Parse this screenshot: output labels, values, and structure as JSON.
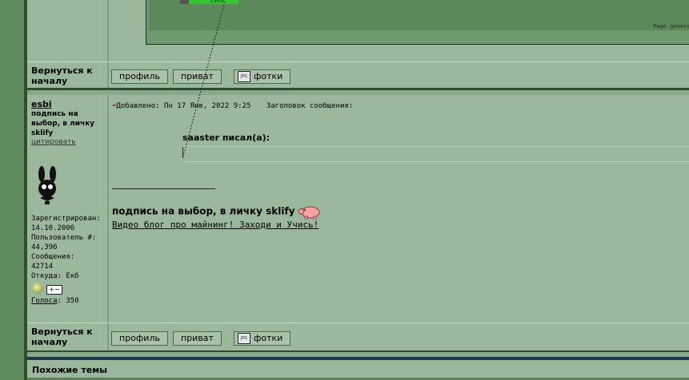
{
  "top_panel": {
    "generation_text": "Page generati",
    "bar_value": "1946"
  },
  "nav": {
    "back_to_top": "Вернуться к началу",
    "profile_button": "профиль",
    "private_button": "приват",
    "photos_button": "фотки",
    "jpg_icon_text": "JPG"
  },
  "post": {
    "author": "esbi",
    "signature_short": "подпись на выбор, в личку sklify",
    "quote_link": "цитировать",
    "registered_label": "Зарегистрирован:",
    "registered_value": "14.10.2006",
    "user_no_label": "Пользователь #:",
    "user_no_value": "44,396",
    "messages_label": "Сообщения:",
    "messages_value": "42714",
    "location_label": "Откуда: Екб",
    "votes_link": "Голоса",
    "votes_value": ": 350",
    "added_label": "Добавлено: Пн 17 Янв, 2022 9:25",
    "subject_label": "Заголовок сообщения:",
    "quote_author": "saaster писал(а):",
    "signature_text": "подпись на выбор, в личку sklify",
    "signature_link": "Видео блог про майнинг! Заходи и Учись!"
  },
  "footer": {
    "similar_topics": "Похожие темы"
  }
}
